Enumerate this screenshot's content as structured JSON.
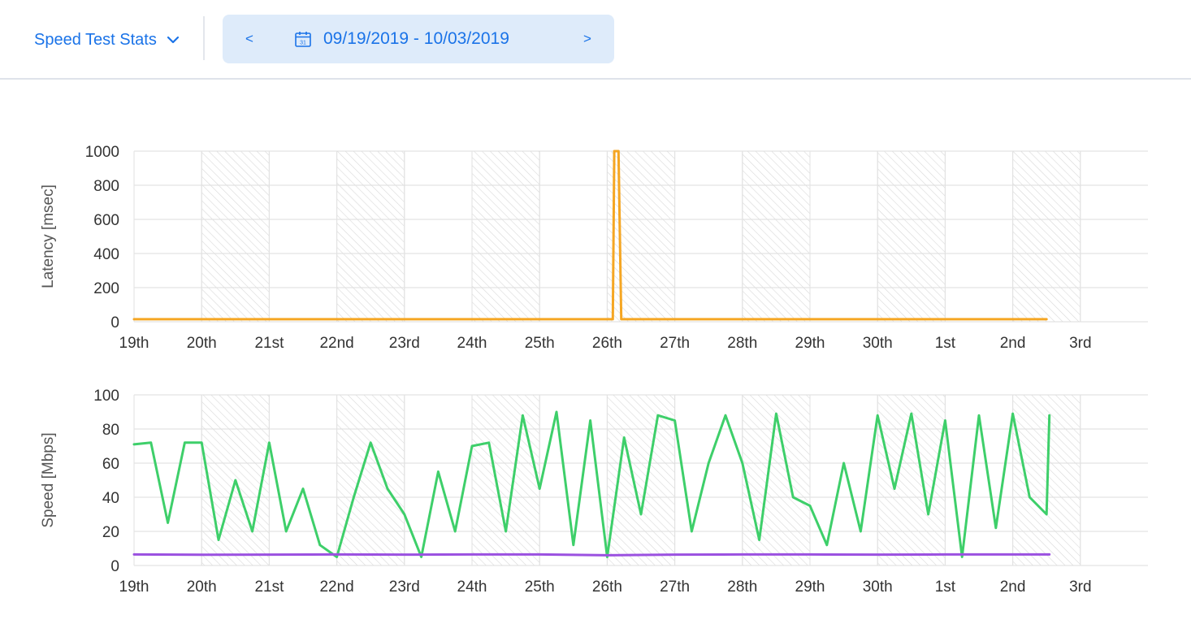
{
  "header": {
    "view_label": "Speed Test Stats",
    "prev_label": "<",
    "next_label": ">",
    "date_range": "09/19/2019 - 10/03/2019",
    "calendar_day": "31"
  },
  "chart_data": [
    {
      "type": "line",
      "ylabel": "Latency [msec]",
      "xlabel": "",
      "ylim": [
        0,
        1000
      ],
      "yticks": [
        0,
        200,
        400,
        600,
        800,
        1000
      ],
      "x_start": "2019-09-19",
      "x_end": "2019-10-03",
      "xticks": [
        "19th",
        "20th",
        "21st",
        "22nd",
        "23rd",
        "24th",
        "25th",
        "26th",
        "27th",
        "28th",
        "29th",
        "30th",
        "1st",
        "2nd",
        "3rd"
      ],
      "shaded_days": [
        "20th",
        "22nd",
        "24th",
        "26th",
        "28th",
        "30th",
        "2nd"
      ],
      "grid": true,
      "legend": "none",
      "colors": [
        "#f5a623"
      ],
      "series": [
        {
          "x": [
            "2019-09-19",
            "2019-09-20",
            "2019-09-21",
            "2019-09-22",
            "2019-09-23",
            "2019-09-24",
            "2019-09-25",
            "2019-09-26 02:00",
            "2019-09-26 02:30",
            "2019-09-26 03:00",
            "2019-09-26 04:00",
            "2019-09-26 05:00",
            "2019-09-27",
            "2019-09-28",
            "2019-09-29",
            "2019-09-30",
            "2019-10-01",
            "2019-10-02",
            "2019-10-02 12:00"
          ],
          "values": [
            15,
            15,
            15,
            15,
            15,
            15,
            15,
            15,
            1000,
            1000,
            1000,
            15,
            15,
            15,
            15,
            15,
            15,
            15,
            15
          ]
        }
      ]
    },
    {
      "type": "line",
      "ylabel": "Speed [Mbps]",
      "xlabel": "",
      "ylim": [
        0,
        100
      ],
      "yticks": [
        0,
        20,
        40,
        60,
        80,
        100
      ],
      "x_start": "2019-09-19",
      "x_end": "2019-10-03",
      "xticks": [
        "19th",
        "20th",
        "21st",
        "22nd",
        "23rd",
        "24th",
        "25th",
        "26th",
        "27th",
        "28th",
        "29th",
        "30th",
        "1st",
        "2nd",
        "3rd"
      ],
      "shaded_days": [
        "20th",
        "22nd",
        "24th",
        "26th",
        "28th",
        "30th",
        "2nd"
      ],
      "grid": true,
      "legend": "none",
      "colors": [
        "#3ecf6a",
        "#9b51e0"
      ],
      "series": [
        {
          "x": [
            "2019-09-19",
            "2019-09-19 06:00",
            "2019-09-19 12:00",
            "2019-09-19 18:00",
            "2019-09-20",
            "2019-09-20 06:00",
            "2019-09-20 12:00",
            "2019-09-20 18:00",
            "2019-09-21",
            "2019-09-21 06:00",
            "2019-09-21 12:00",
            "2019-09-21 18:00",
            "2019-09-22",
            "2019-09-22 06:00",
            "2019-09-22 12:00",
            "2019-09-22 18:00",
            "2019-09-23",
            "2019-09-23 06:00",
            "2019-09-23 12:00",
            "2019-09-23 18:00",
            "2019-09-24",
            "2019-09-24 06:00",
            "2019-09-24 12:00",
            "2019-09-24 18:00",
            "2019-09-25",
            "2019-09-25 06:00",
            "2019-09-25 12:00",
            "2019-09-25 18:00",
            "2019-09-26",
            "2019-09-26 06:00",
            "2019-09-26 12:00",
            "2019-09-26 18:00",
            "2019-09-27",
            "2019-09-27 06:00",
            "2019-09-27 12:00",
            "2019-09-27 18:00",
            "2019-09-28",
            "2019-09-28 06:00",
            "2019-09-28 12:00",
            "2019-09-28 18:00",
            "2019-09-29",
            "2019-09-29 06:00",
            "2019-09-29 12:00",
            "2019-09-29 18:00",
            "2019-09-30",
            "2019-09-30 06:00",
            "2019-09-30 12:00",
            "2019-09-30 18:00",
            "2019-10-01",
            "2019-10-01 06:00",
            "2019-10-01 12:00",
            "2019-10-01 18:00",
            "2019-10-02",
            "2019-10-02 06:00",
            "2019-10-02 12:00",
            "2019-10-02 13:00"
          ],
          "values": [
            71,
            72,
            25,
            72,
            72,
            15,
            50,
            20,
            72,
            20,
            45,
            12,
            5,
            40,
            72,
            45,
            30,
            5,
            55,
            20,
            70,
            72,
            20,
            88,
            45,
            90,
            12,
            85,
            5,
            75,
            30,
            88,
            85,
            20,
            60,
            88,
            60,
            15,
            89,
            40,
            35,
            12,
            60,
            20,
            88,
            45,
            89,
            30,
            85,
            5,
            88,
            22,
            89,
            40,
            30,
            88
          ]
        },
        {
          "x": [
            "2019-09-19",
            "2019-09-20",
            "2019-09-21",
            "2019-09-22",
            "2019-09-23",
            "2019-09-24",
            "2019-09-25",
            "2019-09-26",
            "2019-09-27",
            "2019-09-28",
            "2019-09-29",
            "2019-09-30",
            "2019-10-01",
            "2019-10-02",
            "2019-10-02 13:00"
          ],
          "values": [
            6.5,
            6.3,
            6.4,
            6.5,
            6.4,
            6.5,
            6.5,
            6,
            6.4,
            6.5,
            6.5,
            6.4,
            6.5,
            6.5,
            6.5
          ]
        }
      ]
    }
  ]
}
